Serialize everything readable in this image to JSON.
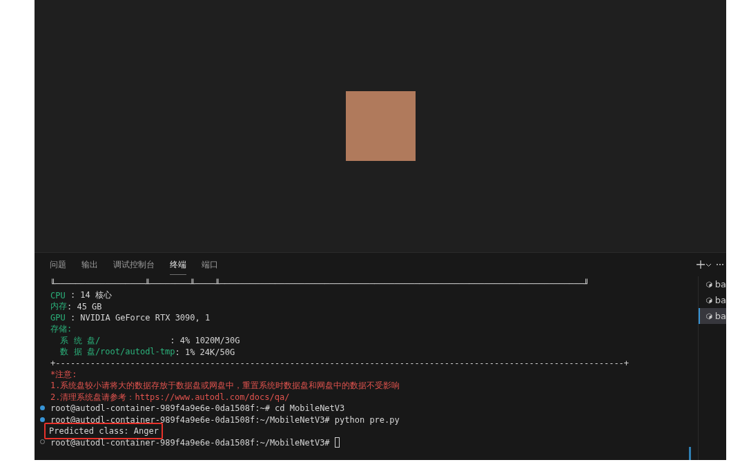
{
  "panel": {
    "tabs": [
      {
        "label": "问题",
        "selected": false
      },
      {
        "label": "输出",
        "selected": false
      },
      {
        "label": "调试控制台",
        "selected": false
      },
      {
        "label": "终端",
        "selected": true
      },
      {
        "label": "端口",
        "selected": false
      }
    ]
  },
  "terminal": {
    "lines": [
      {
        "kind": "output",
        "segments": [
          {
            "kind": "plain",
            "text": "╙──────────────────╨────────╨────╨─────────────────────────────────────────────────────────────────────────╜"
          }
        ]
      },
      {
        "kind": "output",
        "segments": [
          {
            "kind": "label",
            "text": "CPU"
          },
          {
            "kind": "plain",
            "text": " : 14 核心"
          }
        ]
      },
      {
        "kind": "output",
        "segments": [
          {
            "kind": "label",
            "text": "内存"
          },
          {
            "kind": "plain",
            "text": ": 45 GB"
          }
        ]
      },
      {
        "kind": "output",
        "segments": [
          {
            "kind": "label",
            "text": "GPU"
          },
          {
            "kind": "plain",
            "text": " : NVIDIA GeForce RTX 3090, 1"
          }
        ]
      },
      {
        "kind": "output",
        "segments": [
          {
            "kind": "label",
            "text": "存储:"
          }
        ]
      },
      {
        "kind": "output",
        "segments": [
          {
            "kind": "label",
            "text": "  系 统 盘/              "
          },
          {
            "kind": "plain",
            "text": ": 4% 1020M/30G"
          }
        ]
      },
      {
        "kind": "output",
        "segments": [
          {
            "kind": "label",
            "text": "  数 据 盘/root/autodl-tmp"
          },
          {
            "kind": "plain",
            "text": ": 1% 24K/50G"
          }
        ]
      },
      {
        "kind": "output",
        "segments": [
          {
            "kind": "plain",
            "text": "+------------------------------------------------------------------------------------------------------------------+"
          }
        ]
      },
      {
        "kind": "output",
        "segments": [
          {
            "kind": "warning",
            "text": "*注意:"
          }
        ]
      },
      {
        "kind": "output",
        "segments": [
          {
            "kind": "warning",
            "text": "1.系统盘较小请将大的数据存放于数据盘或网盘中，重置系统时数据盘和网盘中的数据不受影响"
          }
        ]
      },
      {
        "kind": "output",
        "segments": [
          {
            "kind": "warning",
            "text": "2.清理系统盘请参考：https://www.autodl.com/docs/qa/"
          }
        ]
      },
      {
        "kind": "command",
        "segments": [
          {
            "kind": "plain",
            "text": "root@autodl-container-989f4a9e6e-0da1508f:~# cd MobileNetV3"
          }
        ]
      },
      {
        "kind": "command",
        "segments": [
          {
            "kind": "plain",
            "text": "root@autodl-container-989f4a9e6e-0da1508f:~/MobileNetV3# python pre.py"
          }
        ]
      },
      {
        "kind": "highlighted",
        "segments": [
          {
            "kind": "plain",
            "text": "Predicted class: Anger"
          }
        ]
      },
      {
        "kind": "input",
        "segments": [
          {
            "kind": "plain",
            "text": "root@autodl-container-989f4a9e6e-0da1508f:~/MobileNetV3# "
          }
        ]
      }
    ]
  },
  "terminal_list": [
    {
      "label": "ba",
      "selected": false
    },
    {
      "label": "ba",
      "selected": false
    },
    {
      "label": "ba",
      "selected": true
    }
  ]
}
